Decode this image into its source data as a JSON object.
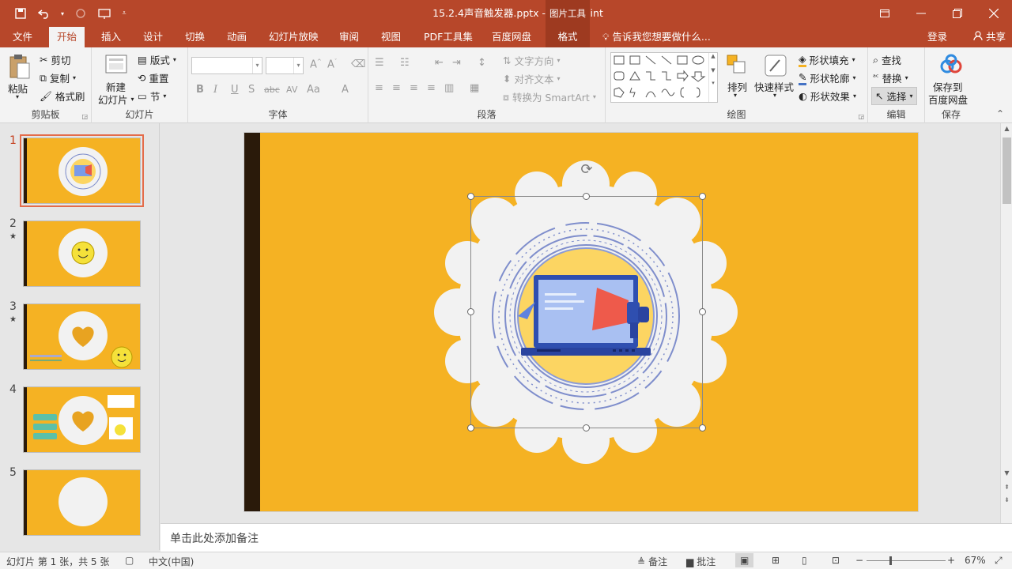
{
  "window": {
    "title": "15.2.4声音触发器.pptx - PowerPoint",
    "context_tab_header": "图片工具",
    "controls": [
      "restore-ribbon",
      "minimize",
      "maximize",
      "close"
    ]
  },
  "tabs": [
    "文件",
    "开始",
    "插入",
    "设计",
    "切换",
    "动画",
    "幻灯片放映",
    "审阅",
    "视图",
    "PDF工具集",
    "百度网盘",
    "格式"
  ],
  "active_tab": "开始",
  "tell_me": "告诉我您想要做什么...",
  "account": {
    "login": "登录",
    "share": "共享"
  },
  "ribbon": {
    "clipboard": {
      "paste": "粘贴",
      "cut": "剪切",
      "copy": "复制",
      "format_painter": "格式刷",
      "label": "剪贴板"
    },
    "slides": {
      "new_slide_line1": "新建",
      "new_slide_line2": "幻灯片",
      "layout": "版式",
      "reset": "重置",
      "section": "节",
      "label": "幻灯片"
    },
    "font": {
      "label": "字体",
      "bold": "B",
      "italic": "I",
      "underline": "U",
      "shadow": "S",
      "strike": "abc",
      "spacing": "AV",
      "case": "Aa",
      "color": "A"
    },
    "paragraph": {
      "label": "段落",
      "text_direction": "文字方向",
      "align_text": "对齐文本",
      "smartart": "转换为 SmartArt"
    },
    "drawing": {
      "label": "绘图",
      "arrange": "排列",
      "quick_styles": "快速样式",
      "shape_fill": "形状填充",
      "shape_outline": "形状轮廓",
      "shape_effects": "形状效果"
    },
    "editing": {
      "label": "编辑",
      "find": "查找",
      "replace": "替换",
      "select": "选择"
    },
    "save": {
      "label": "保存",
      "save_to_line1": "保存到",
      "save_to_line2": "百度网盘"
    }
  },
  "slides_panel": [
    {
      "num": "1",
      "star": false,
      "selected": true,
      "content": "laptop-megaphone-badge"
    },
    {
      "num": "2",
      "star": true,
      "selected": false,
      "content": "smiley-badge"
    },
    {
      "num": "3",
      "star": true,
      "selected": false,
      "content": "heart-badge-with-smiley"
    },
    {
      "num": "4",
      "star": false,
      "selected": false,
      "content": "heart-badge-with-panels"
    },
    {
      "num": "5",
      "star": false,
      "selected": false,
      "content": "empty-badge"
    }
  ],
  "notes_placeholder": "单击此处添加备注",
  "status": {
    "slide_info": "幻灯片 第 1 张，共 5 张",
    "language": "中文(中国)",
    "notes": "备注",
    "comments": "批注",
    "zoom": "67%"
  },
  "colors": {
    "accent": "#b7472a",
    "slide_bg": "#f5b223",
    "slide_bar": "#2a1a0a",
    "badge": "#f2f2f2"
  }
}
